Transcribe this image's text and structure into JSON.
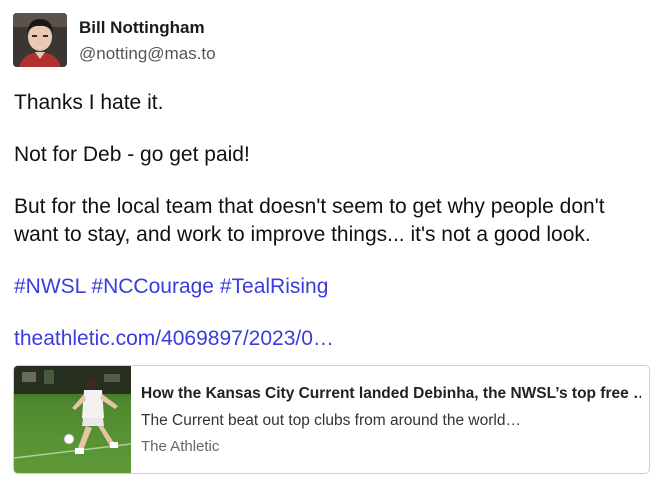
{
  "author": {
    "display_name": "Bill Nottingham",
    "handle": "@notting@mas.to"
  },
  "post": {
    "paragraphs": [
      "Thanks I hate it.",
      "Not for Deb - go get paid!",
      "But for the local team that doesn't seem to get why people don't want to stay, and work to improve things... it's not a good look."
    ],
    "hashtags": [
      "#NWSL",
      "#NCCourage",
      "#TealRising"
    ],
    "link_text": "theathletic.com/4069897/2023/0…"
  },
  "link_card": {
    "title": "How the Kansas City Current landed Debinha, the NWSL’s top free …",
    "description": "The Current beat out top clubs from around the world…",
    "source": "The Athletic"
  },
  "colors": {
    "link": "#3b3bde",
    "handle": "#555555",
    "card_border": "#d0d0d0"
  }
}
